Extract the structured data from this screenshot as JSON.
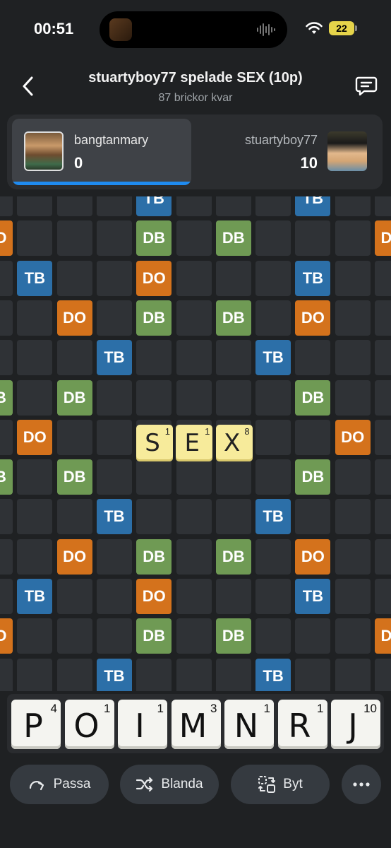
{
  "status_bar": {
    "time": "00:51",
    "battery": "22"
  },
  "header": {
    "title": "stuartyboy77 spelade SEX (10p)",
    "subtitle": "87 brickor kvar"
  },
  "players": {
    "left": {
      "name": "bangtanmary",
      "score": "0"
    },
    "right": {
      "name": "stuartyboy77",
      "score": "10"
    }
  },
  "board": {
    "bonus_labels": {
      "tb": "TB",
      "db": "DB",
      "do": "DO"
    },
    "rows": [
      "____T___T___",
      "O___D_D___O_",
      "_T__O___T___",
      "__O_D_D_O___",
      "___T___T____",
      "B_D_____D__D",
      "_O_______O__",
      "B_D_____D__D",
      "___T___T____",
      "__O_D_D_O___",
      "_T__O___T___",
      "O___D_D___O_",
      "___T___T____"
    ],
    "played_tiles": [
      {
        "letter": "S",
        "points": "1"
      },
      {
        "letter": "E",
        "points": "1"
      },
      {
        "letter": "X",
        "points": "8"
      }
    ]
  },
  "rack": [
    {
      "letter": "P",
      "points": "4"
    },
    {
      "letter": "O",
      "points": "1"
    },
    {
      "letter": "I",
      "points": "1"
    },
    {
      "letter": "M",
      "points": "3"
    },
    {
      "letter": "N",
      "points": "1"
    },
    {
      "letter": "R",
      "points": "1"
    },
    {
      "letter": "J",
      "points": "10"
    }
  ],
  "actions": {
    "pass": "Passa",
    "shuffle": "Blanda",
    "swap": "Byt"
  },
  "icons": {
    "back": "chevron-left-icon",
    "chat": "chat-icon",
    "pass": "redo-arrow-icon",
    "shuffle": "shuffle-icon",
    "swap": "swap-icon",
    "more": "more-icon"
  }
}
